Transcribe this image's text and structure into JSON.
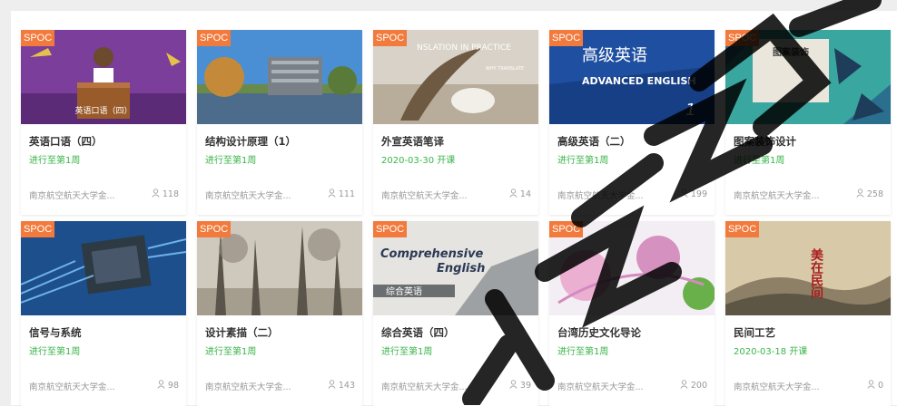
{
  "badge": "SPOC",
  "cards": [
    {
      "title": "英语口语（四）",
      "status": "进行至第1周",
      "school": "南京航空航天大学金...",
      "count": "118",
      "thumb_caption": "英语口语（四）"
    },
    {
      "title": "结构设计原理（1）",
      "status": "进行至第1周",
      "school": "南京航空航天大学金...",
      "count": "111"
    },
    {
      "title": "外宣英语笔译",
      "status": "2020-03-30 开课",
      "school": "南京航空航天大学金...",
      "count": "14",
      "thumb_caption": "NSLATION IN PRACTICE",
      "thumb_sub": "WHY TRANSLATE"
    },
    {
      "title": "高级英语（二）",
      "status": "进行至第1周",
      "school": "南京航空航天大学金...",
      "count": "199",
      "thumb_caption": "高级英语",
      "thumb_sub": "ADVANCED ENGLISH",
      "thumb_num": "1"
    },
    {
      "title": "图案装饰设计",
      "status": "进行至第1周",
      "school": "南京航空航天大学金...",
      "count": "258",
      "thumb_caption": "图案装饰"
    },
    {
      "title": "信号与系统",
      "status": "进行至第1周",
      "school": "南京航空航天大学金...",
      "count": "98"
    },
    {
      "title": "设计素描（二）",
      "status": "进行至第1周",
      "school": "南京航空航天大学金...",
      "count": "143"
    },
    {
      "title": "综合英语（四）",
      "status": "进行至第1周",
      "school": "南京航空航天大学金...",
      "count": "39",
      "thumb_caption": "Comprehensive",
      "thumb_sub": "English",
      "thumb_cn": "综合英语"
    },
    {
      "title": "台湾历史文化导论",
      "status": "进行至第1周",
      "school": "南京航空航天大学金...",
      "count": "200"
    },
    {
      "title": "民间工艺",
      "status": "2020-03-18 开课",
      "school": "南京航空航天大学金...",
      "count": "0",
      "thumb_caption": "美在民间"
    }
  ],
  "colors": {
    "badge": "#f27a3c",
    "status": "#39b54a",
    "watermark": "#000000"
  }
}
